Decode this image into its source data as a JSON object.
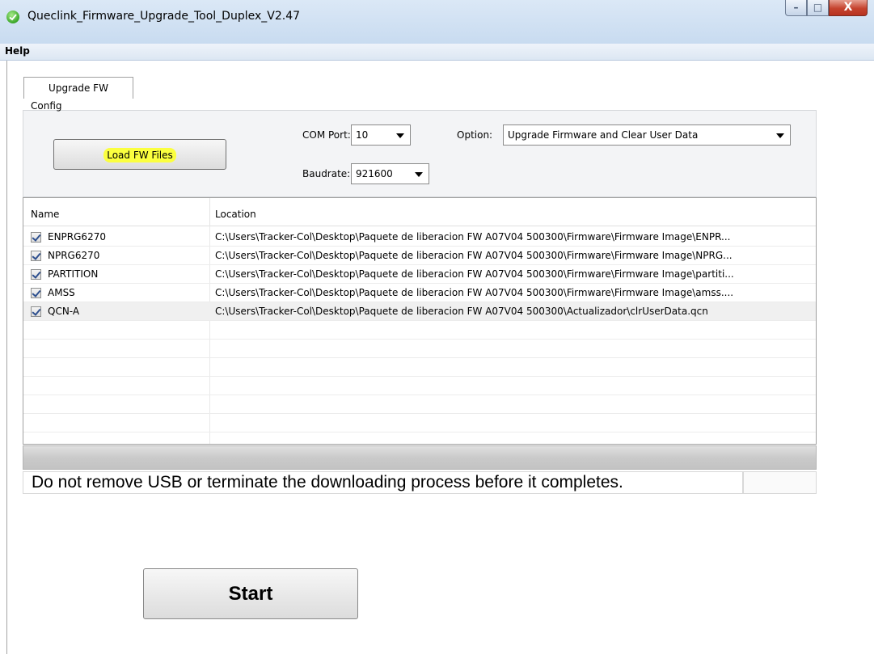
{
  "window": {
    "title": "Queclink_Firmware_Upgrade_Tool_Duplex_V2.47",
    "controls": {
      "minimize": "–",
      "maximize": "□",
      "close": "X"
    }
  },
  "menu": {
    "help": "Help"
  },
  "tabs": [
    {
      "label": "Upgrade FW",
      "active": true
    }
  ],
  "config": {
    "group_label": "Config",
    "load_button": "Load FW Files",
    "com_port_label": "COM Port:",
    "com_port_value": "10",
    "baudrate_label": "Baudrate:",
    "baudrate_value": "921600",
    "option_label": "Option:",
    "option_value": "Upgrade Firmware and Clear User Data"
  },
  "file_list": {
    "columns": [
      "Name",
      "Location"
    ],
    "rows": [
      {
        "name": "ENPRG6270",
        "checked": true,
        "location": "C:\\Users\\Tracker-Col\\Desktop\\Paquete  de liberacion FW  A07V04 500300\\Firmware\\Firmware Image\\ENPR..."
      },
      {
        "name": "NPRG6270",
        "checked": true,
        "location": "C:\\Users\\Tracker-Col\\Desktop\\Paquete  de liberacion FW  A07V04 500300\\Firmware\\Firmware Image\\NPRG..."
      },
      {
        "name": "PARTITION",
        "checked": true,
        "location": "C:\\Users\\Tracker-Col\\Desktop\\Paquete  de liberacion FW  A07V04 500300\\Firmware\\Firmware Image\\partiti..."
      },
      {
        "name": "AMSS",
        "checked": true,
        "location": "C:\\Users\\Tracker-Col\\Desktop\\Paquete  de liberacion FW  A07V04 500300\\Firmware\\Firmware Image\\amss...."
      },
      {
        "name": "QCN-A",
        "checked": true,
        "location": "C:\\Users\\Tracker-Col\\Desktop\\Paquete  de liberacion FW  A07V04 500300\\Actualizador\\clrUserData.qcn"
      }
    ]
  },
  "progress": {
    "value": 0
  },
  "status_message": "Do not remove USB or terminate the downloading process before it completes.",
  "start_button": "Start",
  "colors": {
    "highlight": "#fbff3f",
    "title_bar": "#c8dbf0",
    "close_button": "#c5432e"
  }
}
